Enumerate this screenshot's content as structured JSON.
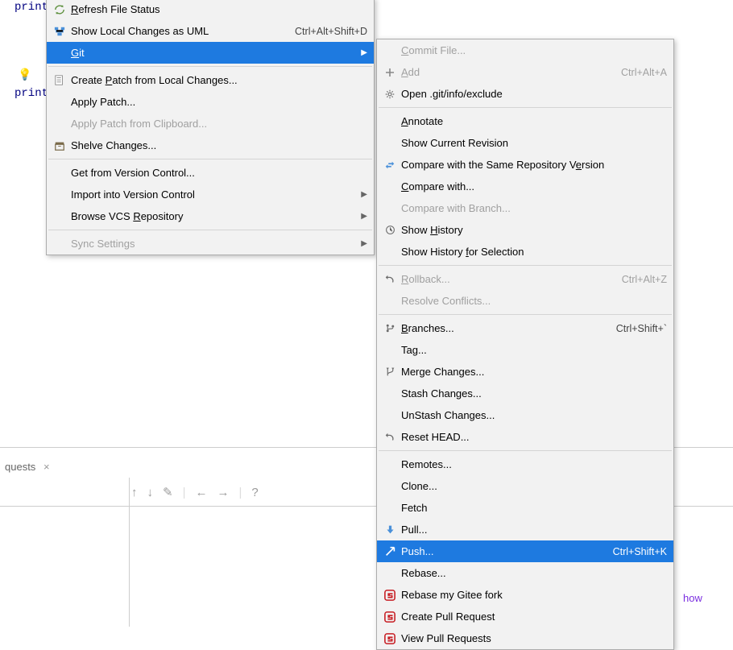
{
  "editor": {
    "line1": "print",
    "line2": "print",
    "bulb_icon": "💡"
  },
  "tab": {
    "label": "quests",
    "close": "×"
  },
  "toolbar": {
    "up": "↑",
    "down": "↓",
    "edit": "✎",
    "left": "←",
    "right": "→",
    "help": "?"
  },
  "link": "how",
  "menu_primary": [
    {
      "name": "refresh-file-status",
      "label": "Refresh File Status",
      "icon": "refresh",
      "u": 0
    },
    {
      "name": "show-local-changes-uml",
      "label": "Show Local Changes as UML",
      "icon": "uml",
      "shortcut": "Ctrl+Alt+Shift+D"
    },
    {
      "name": "git",
      "label": "Git",
      "u": 0,
      "selected": true,
      "submenu": true
    },
    {
      "sep": true
    },
    {
      "name": "create-patch",
      "label": "Create Patch from Local Changes...",
      "icon": "patch",
      "u": 7
    },
    {
      "name": "apply-patch",
      "label": "Apply Patch..."
    },
    {
      "name": "apply-patch-clipboard",
      "label": "Apply Patch from Clipboard...",
      "disabled": true
    },
    {
      "name": "shelve-changes",
      "label": "Shelve Changes...",
      "icon": "shelve"
    },
    {
      "sep": true
    },
    {
      "name": "get-from-vc",
      "label": "Get from Version Control..."
    },
    {
      "name": "import-into-vc",
      "label": "Import into Version Control",
      "submenu": true
    },
    {
      "name": "browse-vcs-repo",
      "label": "Browse VCS Repository",
      "submenu": true,
      "u": 11
    },
    {
      "sep": true
    },
    {
      "name": "sync-settings",
      "label": "Sync Settings",
      "submenu": true,
      "disabled": true
    }
  ],
  "menu_secondary": [
    {
      "name": "commit-file",
      "label": "Commit File...",
      "disabled": true,
      "u": 0
    },
    {
      "name": "add",
      "label": "Add",
      "icon": "plus",
      "shortcut": "Ctrl+Alt+A",
      "u": 0,
      "disabled": true
    },
    {
      "name": "open-git-exclude",
      "label": "Open .git/info/exclude",
      "icon": "gear"
    },
    {
      "sep": true
    },
    {
      "name": "annotate",
      "label": "Annotate",
      "u": 0
    },
    {
      "name": "show-current-revision",
      "label": "Show Current Revision"
    },
    {
      "name": "compare-same-repo",
      "label": "Compare with the Same Repository Version",
      "icon": "compare",
      "u": 34
    },
    {
      "name": "compare-with",
      "label": "Compare with...",
      "u": 0
    },
    {
      "name": "compare-with-branch",
      "label": "Compare with Branch...",
      "disabled": true
    },
    {
      "name": "show-history",
      "label": "Show History",
      "icon": "clock",
      "u": 5
    },
    {
      "name": "show-history-selection",
      "label": "Show History for Selection",
      "u": 13
    },
    {
      "sep": true
    },
    {
      "name": "rollback",
      "label": "Rollback...",
      "icon": "undo",
      "shortcut": "Ctrl+Alt+Z",
      "disabled": true,
      "u": 0
    },
    {
      "name": "resolve-conflicts",
      "label": "Resolve Conflicts...",
      "disabled": true
    },
    {
      "sep": true
    },
    {
      "name": "branches",
      "label": "Branches...",
      "icon": "branch",
      "shortcut": "Ctrl+Shift+`",
      "u": 0
    },
    {
      "name": "tag",
      "label": "Tag..."
    },
    {
      "name": "merge-changes",
      "label": "Merge Changes...",
      "icon": "merge"
    },
    {
      "name": "stash-changes",
      "label": "Stash Changes..."
    },
    {
      "name": "unstash-changes",
      "label": "UnStash Changes..."
    },
    {
      "name": "reset-head",
      "label": "Reset HEAD...",
      "icon": "undo"
    },
    {
      "sep": true
    },
    {
      "name": "remotes",
      "label": "Remotes..."
    },
    {
      "name": "clone",
      "label": "Clone..."
    },
    {
      "name": "fetch",
      "label": "Fetch"
    },
    {
      "name": "pull",
      "label": "Pull...",
      "icon": "pull"
    },
    {
      "name": "push",
      "label": "Push...",
      "icon": "push",
      "shortcut": "Ctrl+Shift+K",
      "selected": true
    },
    {
      "name": "rebase",
      "label": "Rebase..."
    },
    {
      "name": "rebase-gitee",
      "label": "Rebase my Gitee fork",
      "icon": "gitee"
    },
    {
      "name": "create-pr",
      "label": "Create Pull Request",
      "icon": "gitee"
    },
    {
      "name": "view-pr",
      "label": "View Pull Requests",
      "icon": "gitee"
    }
  ]
}
